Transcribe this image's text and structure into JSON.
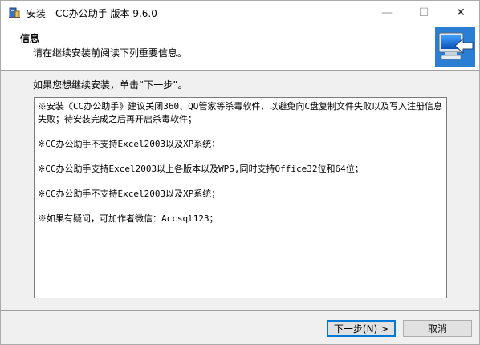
{
  "window": {
    "title": "安装 - CC办公助手 版本 9.6.0",
    "minimize_glyph": "—",
    "maximize_glyph": "☐",
    "close_glyph": "✕"
  },
  "header": {
    "title": "信息",
    "subtitle": "请在继续安装前阅读下列重要信息。",
    "icon": "installer-computer-arrow-icon"
  },
  "main": {
    "prompt": "如果您想继续安装，单击“下一步”。",
    "memo_lines": [
      "※安装《CC办公助手》建议关闭360、QQ管家等杀毒软件，以避免向C盘复制文件失败以及写入注册信息失败；待安装完成之后再开启杀毒软件；",
      "",
      "※CC办公助手不支持Excel2003以及XP系统；",
      "",
      "※CC办公助手支持Excel2003以上各版本以及WPS,同时支持Office32位和64位；",
      "",
      "※CC办公助手不支持Excel2003以及XP系统；",
      "",
      "※如果有疑问，可加作者微信：Accsql123；"
    ]
  },
  "footer": {
    "watermark": "",
    "next_label": "下一步(N) >",
    "cancel_label": "取消"
  },
  "colors": {
    "accent": "#0078d7",
    "panel": "#f0f0f0",
    "header_bg": "#ffffff"
  }
}
